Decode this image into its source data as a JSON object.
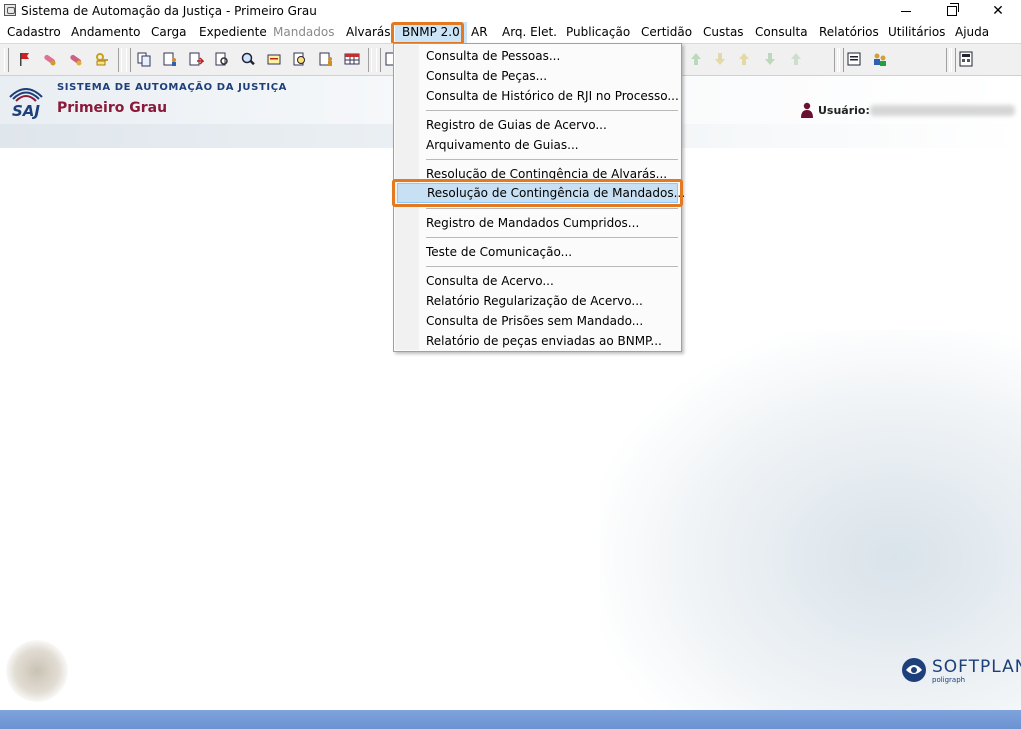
{
  "window": {
    "title": "Sistema de Automação da Justiça - Primeiro Grau",
    "minimize": "minimize",
    "maximize": "restore",
    "close": "✕"
  },
  "menubar": [
    {
      "label": "Cadastro",
      "state": "normal"
    },
    {
      "label": "Andamento",
      "state": "normal"
    },
    {
      "label": "Carga",
      "state": "normal"
    },
    {
      "label": "Expediente",
      "state": "normal"
    },
    {
      "label": "Mandados",
      "state": "disabled"
    },
    {
      "label": "Alvarás",
      "state": "normal"
    },
    {
      "label": "BNMP 2.0",
      "state": "open"
    },
    {
      "label": "AR",
      "state": "normal"
    },
    {
      "label": "Arq. Elet.",
      "state": "normal"
    },
    {
      "label": "Publicação",
      "state": "normal"
    },
    {
      "label": "Certidão",
      "state": "normal"
    },
    {
      "label": "Custas",
      "state": "normal"
    },
    {
      "label": "Consulta",
      "state": "normal"
    },
    {
      "label": "Relatórios",
      "state": "normal"
    },
    {
      "label": "Utilitários",
      "state": "normal"
    },
    {
      "label": "Ajuda",
      "state": "normal"
    }
  ],
  "toolbar": {
    "icons": [
      "flag-icon",
      "pill-icon",
      "pill-alt-icon",
      "keys-icon",
      "doc-copy-icon",
      "doc-person-icon",
      "doc-arrow-icon",
      "doc-search-icon",
      "magnifier-icon",
      "doc-highlight-icon",
      "magnifier-doc-icon",
      "doc-person-alt-icon",
      "table-icon",
      "doc-stamp-icon",
      "arrow-up-icon",
      "arrow-down-icon",
      "arrow-up-alt-icon",
      "arrow-down-alt-icon",
      "arrow-up-faded-icon",
      "report-icon",
      "people-icon",
      "calculator-icon"
    ]
  },
  "header": {
    "saj": "SAJ",
    "system_name": "SISTEMA DE AUTOMAÇÃO DA JUSTIÇA",
    "grau": "Primeiro Grau",
    "user_label": "Usuário:"
  },
  "dropdown": {
    "groups": [
      [
        "Consulta de Pessoas...",
        "Consulta de Peças...",
        "Consulta de Histórico de RJI no Processo..."
      ],
      [
        "Registro de Guias de Acervo...",
        "Arquivamento de Guias..."
      ],
      [
        "Resolução de Contingência de Alvarás...",
        "Resolução de Contingência de Mandados..."
      ],
      [
        "Registro de Mandados Cumpridos..."
      ],
      [
        "Teste de Comunicação..."
      ],
      [
        "Consulta de Acervo...",
        "Relatório Regularização de Acervo...",
        "Consulta de Prisões sem Mandado...",
        "Relatório de peças enviadas ao BNMP..."
      ]
    ],
    "hovered": "Resolução de Contingência de Mandados..."
  },
  "branding": {
    "softplan": "SOFTPLAN",
    "softplan_sub": "poligraph"
  },
  "colors": {
    "highlight": "#e37a22",
    "menu_hover": "#c8e0f4",
    "saj_blue": "#1d3f7a",
    "grau_red": "#8a1a3a",
    "status_bar": "#6a93d2"
  }
}
